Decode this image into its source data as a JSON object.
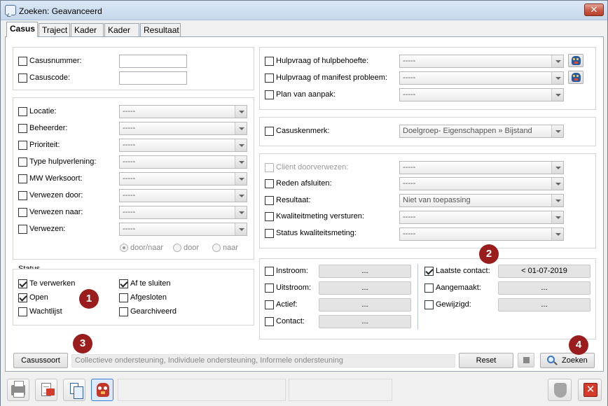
{
  "window": {
    "title": "Zoeken: Geavanceerd",
    "close_glyph": "✕"
  },
  "tabs": [
    "Casus",
    "Traject",
    "Kader I",
    "Kader II",
    "Resultaat"
  ],
  "case_ids": {
    "casusnummer": {
      "label": "Casusnummer:",
      "value": ""
    },
    "casuscode": {
      "label": "Casuscode:",
      "value": ""
    }
  },
  "filters_left": [
    {
      "label": "Locatie:",
      "value": "-----"
    },
    {
      "label": "Beheerder:",
      "value": "-----"
    },
    {
      "label": "Prioriteit:",
      "value": "-----"
    },
    {
      "label": "Type hulpverlening:",
      "value": "-----"
    },
    {
      "label": "MW Werksoort:",
      "value": "-----"
    },
    {
      "label": "Verwezen door:",
      "value": "-----"
    },
    {
      "label": "Verwezen naar:",
      "value": "-----"
    },
    {
      "label": "Verwezen:",
      "value": "-----"
    }
  ],
  "direction_radios": [
    {
      "label": "door/naar",
      "checked": true
    },
    {
      "label": "door",
      "checked": false
    },
    {
      "label": "naar",
      "checked": false
    }
  ],
  "status": {
    "title": "Status",
    "items": [
      {
        "label": "Te verwerken",
        "checked": true
      },
      {
        "label": "Open",
        "checked": true
      },
      {
        "label": "Wachtlijst",
        "checked": false
      },
      {
        "label": "Af te sluiten",
        "checked": true
      },
      {
        "label": "Afgesloten",
        "checked": false
      },
      {
        "label": "Gearchiveerd",
        "checked": false
      }
    ]
  },
  "help_filters": [
    {
      "label": "Hulpvraag of hulpbehoefte:",
      "value": "-----",
      "has_owl": true
    },
    {
      "label": "Hulpvraag of manifest probleem:",
      "value": "-----",
      "has_owl": true
    },
    {
      "label": "Plan van aanpak:",
      "value": "-----",
      "has_owl": false
    }
  ],
  "casuskenmerk": {
    "label": "Casuskenmerk:",
    "value": "Doelgroep- Eigenschappen » Bijstand"
  },
  "closing_filters": [
    {
      "label": "Cliënt doorverwezen:",
      "value": "-----",
      "disabled": true
    },
    {
      "label": "Reden afsluiten:",
      "value": "-----",
      "disabled": false
    },
    {
      "label": "Resultaat:",
      "value": "Niet van toepassing",
      "disabled": false
    },
    {
      "label": "Kwaliteitmeting versturen:",
      "value": "-----",
      "disabled": false
    },
    {
      "label": "Status kwaliteitsmeting:",
      "value": "-----",
      "disabled": false
    }
  ],
  "date_filters_left": [
    {
      "label": "Instroom:",
      "value": "...",
      "checked": false
    },
    {
      "label": "Uitstroom:",
      "value": "...",
      "checked": false
    },
    {
      "label": "Actief:",
      "value": "...",
      "checked": false
    },
    {
      "label": "Contact:",
      "value": "...",
      "checked": false
    }
  ],
  "date_filters_right": [
    {
      "label": "Laatste contact:",
      "value": "< 01-07-2019",
      "checked": true
    },
    {
      "label": "Aangemaakt:",
      "value": "...",
      "checked": false
    },
    {
      "label": "Gewijzigd:",
      "value": "...",
      "checked": false
    }
  ],
  "casussoort": {
    "button": "Casussoort",
    "value": "Collectieve ondersteuning, Individuele ondersteuning, Informele ondersteuning"
  },
  "actions": {
    "reset": "Reset",
    "search": "Zoeken"
  },
  "badges": [
    "1",
    "2",
    "3",
    "4"
  ],
  "icons": [
    "window-app-icon",
    "printer-icon",
    "export-document-icon",
    "copy-document-icon",
    "owl-icon",
    "shield-icon",
    "exit-icon",
    "magnifier-icon",
    "stop-icon"
  ],
  "colors": {
    "badge": "#9b1c1c",
    "exit": "#d63a2a",
    "title_bar": "#c5d7eb"
  }
}
